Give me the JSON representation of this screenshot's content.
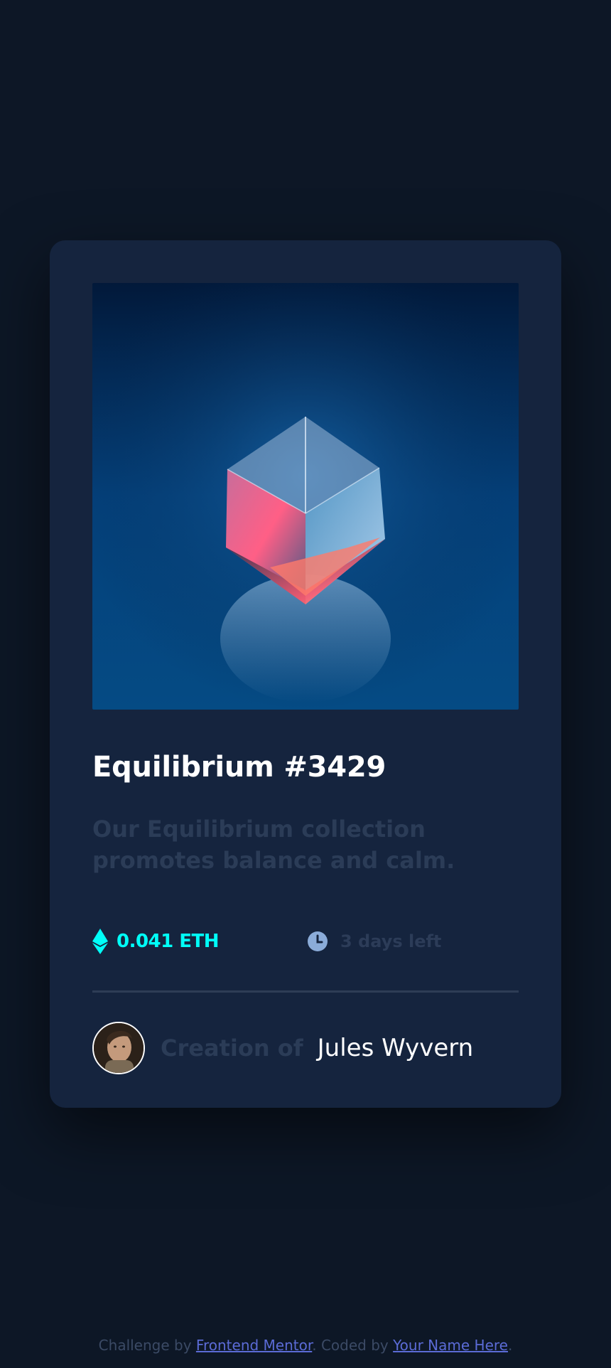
{
  "card": {
    "title": "Equilibrium #3429",
    "description": "Our Equilibrium collection promotes balance and calm.",
    "price": "0.041 ETH",
    "time_left": "3 days left",
    "creator_label": "Creation of",
    "creator_name": "Jules Wyvern"
  },
  "footer": {
    "prefix": "Challenge by ",
    "link1": "Frontend Mentor",
    "middle": ". Coded by ",
    "link2": "Your Name Here",
    "suffix": "."
  },
  "icons": {
    "price": "ethereum-icon",
    "time": "clock-icon",
    "avatar": "avatar-image"
  },
  "colors": {
    "page_bg": "#0d1726",
    "card_bg": "#15243e",
    "accent_cyan": "#00fff8",
    "muted_text": "#2b3c57",
    "white": "#ffffff",
    "link": "#5b6bd6"
  }
}
